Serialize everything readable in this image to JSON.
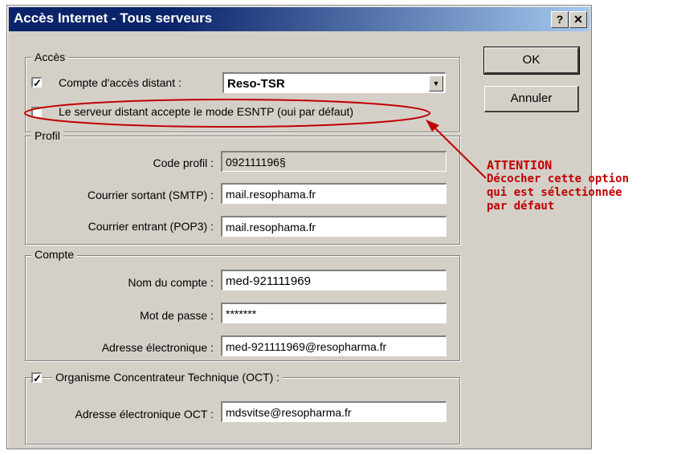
{
  "window": {
    "title": "Accès Internet - Tous serveurs",
    "help_button": "?",
    "close_button": "✕"
  },
  "buttons": {
    "ok": "OK",
    "cancel": "Annuler"
  },
  "acces": {
    "legend": "Accès",
    "remote_account_label": "Compte d'accès distant :",
    "remote_account_checked": true,
    "remote_account_value": "Reso-TSR",
    "esntp_label": "Le serveur distant accepte le mode ESNTP (oui par défaut)",
    "esntp_checked": false
  },
  "profil": {
    "legend": "Profil",
    "code_label": "Code profil :",
    "code_value": "092111196§",
    "smtp_label": "Courrier sortant (SMTP) :",
    "smtp_value": "mail.resophama.fr",
    "pop3_label": "Courrier entrant (POP3) :",
    "pop3_value": "mail.resophama.fr"
  },
  "compte": {
    "legend": "Compte",
    "name_label": "Nom du compte :",
    "name_value": "med-921111969",
    "password_label": "Mot de passe :",
    "password_value": "*******",
    "email_label": "Adresse électronique :",
    "email_value": "med-921111969@resopharma.fr"
  },
  "oct": {
    "label": "Organisme Concentrateur Technique (OCT) :",
    "checked": true,
    "email_label": "Adresse électronique OCT :",
    "email_value": "mdsvitse@resopharma.fr"
  },
  "annotation": {
    "title": "ATTENTION",
    "lines": [
      "Décocher cette option",
      "qui est sélectionnée",
      "par défaut"
    ],
    "color": "#c00000"
  }
}
